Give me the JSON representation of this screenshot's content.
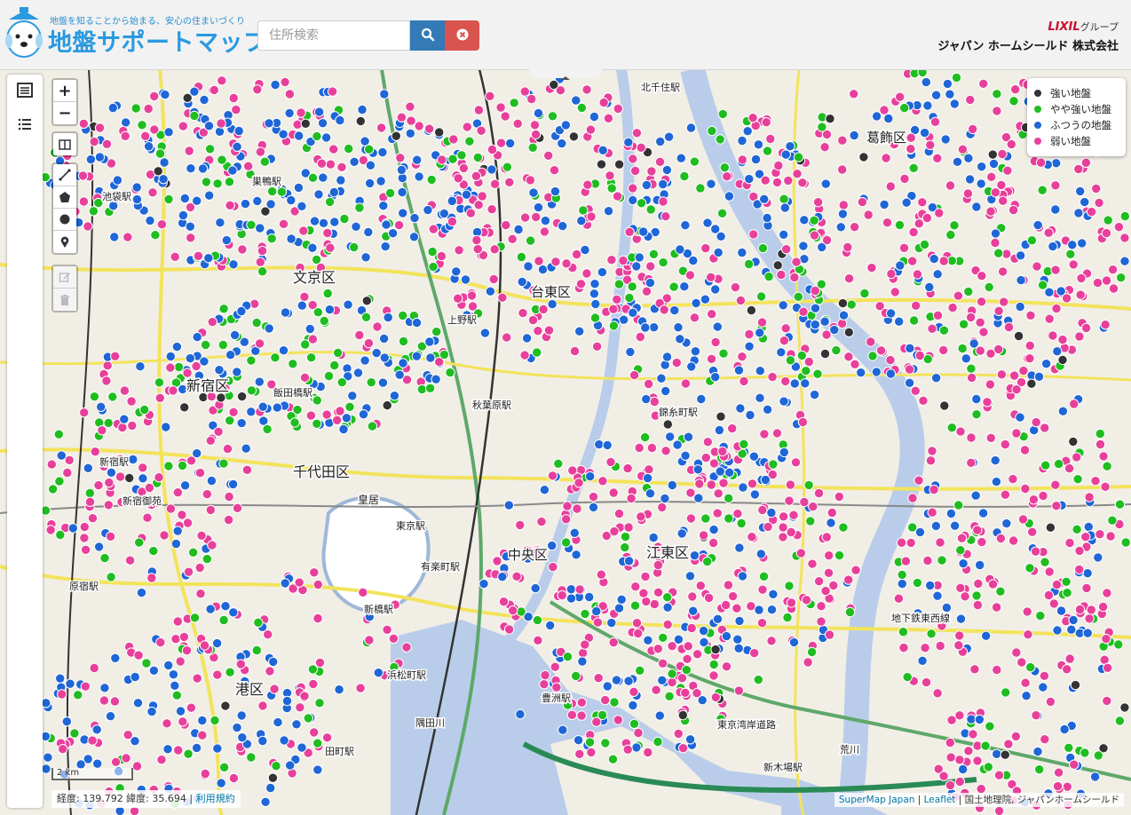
{
  "header": {
    "tagline": "地盤を知ることから始まる、安心の住まいづくり",
    "title": "地盤サポートマップ",
    "brand_mark": "LIXIL",
    "brand_suffix": "グループ",
    "company": "ジャパン ホームシールド 株式会社"
  },
  "search": {
    "placeholder": "住所検索",
    "value": "",
    "search_icon": "search-icon",
    "clear_icon": "times-circle-icon"
  },
  "colors": {
    "strong": "#333333",
    "somewhat_strong": "#1fbd1f",
    "normal": "#1f66d6",
    "weak": "#e8409a",
    "search_button": "#337ab7",
    "clear_button": "#d9534f",
    "brand_blue": "#2a9ae0"
  },
  "sidebar": {
    "buttons": [
      {
        "icon": "list-alt-icon"
      },
      {
        "icon": "list-icon"
      }
    ]
  },
  "controls": {
    "zoom_in": "+",
    "zoom_out": "−",
    "tools": [
      "layout-icon",
      "draw-line-icon",
      "draw-polygon-icon",
      "draw-circle-icon",
      "marker-icon"
    ],
    "edit_tools": [
      "edit-icon",
      "trash-icon"
    ]
  },
  "legend": {
    "items": [
      {
        "label": "強い地盤",
        "key": "strong"
      },
      {
        "label": "やや強い地盤",
        "key": "somewhat_strong"
      },
      {
        "label": "ふつうの地盤",
        "key": "normal"
      },
      {
        "label": "弱い地盤",
        "key": "weak"
      }
    ]
  },
  "map": {
    "labels": {
      "bunkyo": "文京区",
      "chiyoda": "千代田区",
      "shinjuku": "新宿区",
      "chuo": "中央区",
      "koto": "江東区",
      "minato": "港区",
      "taito": "台東区",
      "katsushika": "葛飾区",
      "ikebukuro": "池袋駅",
      "shinjuku_sta": "新宿駅",
      "tokyo_sta": "東京駅",
      "ueno_sta": "上野駅",
      "akihabara": "秋葉原駅",
      "kinshicho": "錦糸町駅",
      "yurakucho": "有楽町駅",
      "shinbashi": "新橋駅",
      "hamamatsucho": "浜松町駅",
      "toyosu": "豊洲駅",
      "shinjuku_gyoen": "新宿御苑",
      "harajuku": "原宿駅",
      "kokyo": "皇居",
      "highway_bay": "東京湾岸道路",
      "chikatetsu_tozai": "地下鉄東西線",
      "iidabashi": "飯田橋駅",
      "sugamo": "巣鴨駅",
      "kitasenju": "北千住駅",
      "tamachi": "田町駅",
      "shinkiba": "新木場駅",
      "arakawa": "荒川",
      "sumidagawa": "隅田川"
    }
  },
  "scale_label": "2 km",
  "coords": {
    "text": "経度: 139.792 緯度: 35.694 |",
    "terms": "利用規約"
  },
  "attribution": {
    "parts": [
      "SuperMap Japan",
      "Leaflet",
      "国土地理院, ジャパンホームシールド"
    ]
  }
}
